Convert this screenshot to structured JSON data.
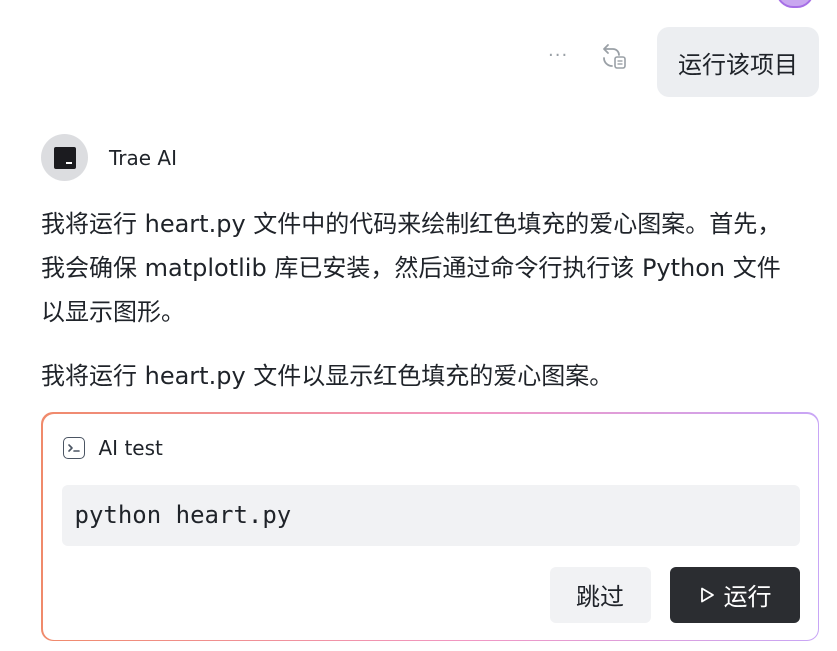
{
  "user_message": {
    "text": "运行该项目",
    "more_icon": "more-horizontal-icon",
    "rerun_icon": "rerun-icon"
  },
  "ai": {
    "name": "Trae AI",
    "avatar_icon": "trae-logo-icon",
    "paragraphs": [
      "我将运行 heart.py 文件中的代码来绘制红色填充的爱心图案。首先，我会确保 matplotlib 库已安装，然后通过命令行执行该 Python 文件以显示图形。",
      "我将运行 heart.py 文件以显示红色填充的爱心图案。"
    ]
  },
  "terminal": {
    "title": "AI test",
    "icon": "terminal-icon",
    "command": "python heart.py",
    "skip_label": "跳过",
    "run_label": "运行"
  },
  "colors": {
    "accent_gradient": [
      "#f08a6b",
      "#f197c3",
      "#c8a6f6"
    ],
    "run_button_bg": "#2b2d31"
  }
}
